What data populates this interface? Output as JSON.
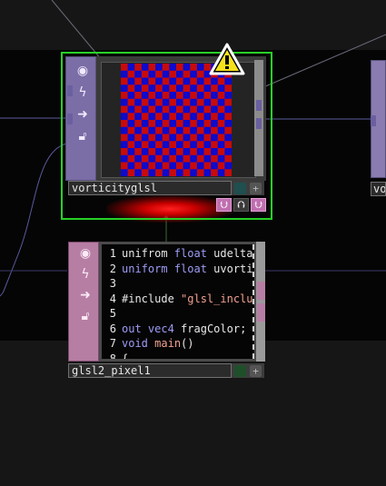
{
  "nodes": {
    "vorticity": {
      "name": "vorticityglsl",
      "side_icons": [
        "viewer-icon",
        "cook-bolt-icon",
        "arrow-right-icon",
        "lock-icon"
      ],
      "has_warning": true,
      "flag_icons": {
        "down_left": "⮋",
        "up": "⮉",
        "down_right": "⮋"
      }
    },
    "pixel": {
      "name": "glsl2_pixel1",
      "side_icons": [
        "viewer-icon",
        "cook-bolt-icon",
        "arrow-right-icon",
        "lock-icon"
      ],
      "code_lines": [
        {
          "num": "1",
          "parts": [
            [
              "",
              "unifrom "
            ],
            [
              "kw",
              "float"
            ],
            [
              "",
              " udelta"
            ]
          ]
        },
        {
          "num": "2",
          "parts": [
            [
              "kw",
              "uniform"
            ],
            [
              "",
              " "
            ],
            [
              "kw",
              "float"
            ],
            [
              "",
              " uvorti"
            ]
          ]
        },
        {
          "num": "3",
          "parts": []
        },
        {
          "num": "4",
          "parts": [
            [
              "",
              "#include "
            ],
            [
              "str",
              "\"glsl_inclu"
            ]
          ]
        },
        {
          "num": "5",
          "parts": []
        },
        {
          "num": "6",
          "parts": [
            [
              "kw",
              "out"
            ],
            [
              "",
              " "
            ],
            [
              "kw",
              "vec4"
            ],
            [
              "",
              " fragColor;"
            ]
          ]
        },
        {
          "num": "7",
          "parts": [
            [
              "kw",
              "void"
            ],
            [
              "",
              " "
            ],
            [
              "str",
              "main"
            ],
            [
              "",
              "()"
            ]
          ]
        },
        {
          "num": "8",
          "parts": [
            [
              "",
              "{"
            ]
          ]
        }
      ]
    },
    "partial_right": {
      "name": "vo"
    }
  },
  "colors": {
    "selection": "#28d028",
    "top_node": "#7b6da6",
    "pixel_node": "#b77ea4",
    "checker_red": "#c80a0a",
    "checker_blue": "#0a0ad0",
    "warning": "#f5e21c"
  }
}
